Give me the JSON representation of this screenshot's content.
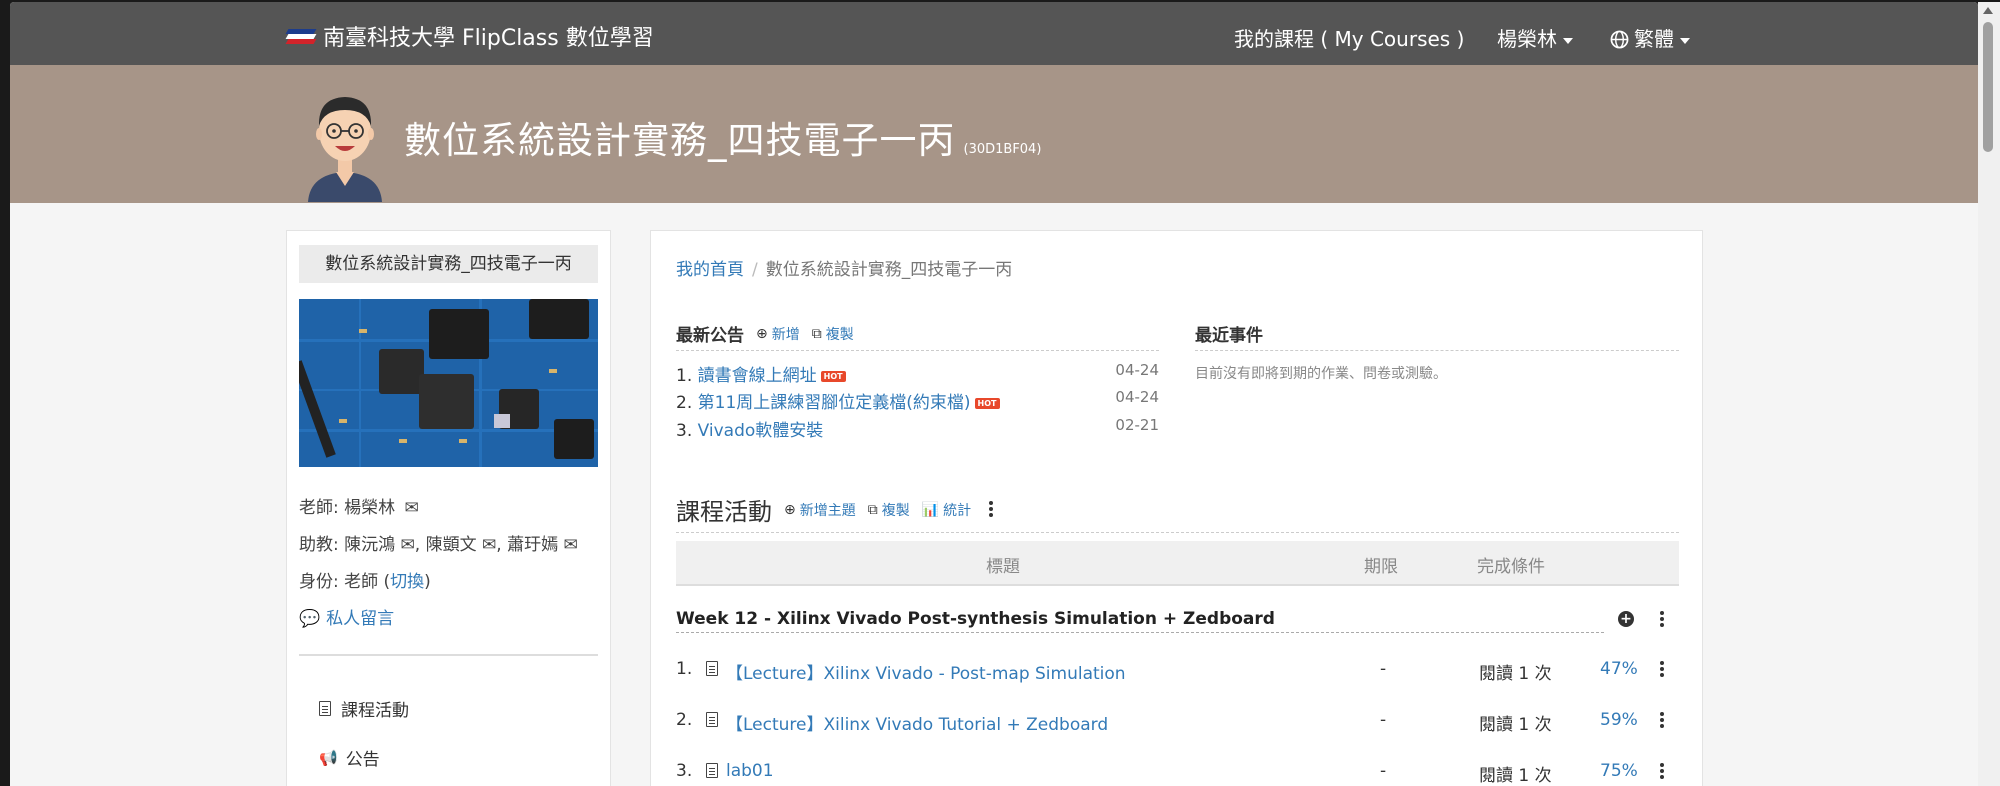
{
  "navbar": {
    "brand": "南臺科技大學 FlipClass 數位學習",
    "my_courses": "我的課程 ( My Courses )",
    "user": "楊榮林",
    "language": "繁體"
  },
  "banner": {
    "course_title": "數位系統設計實務_四技電子一丙",
    "course_code": "(30D1BF04)"
  },
  "sidebar": {
    "title": "數位系統設計實務_四技電子一丙",
    "teacher_label": "老師: 楊榮林",
    "ta_label": "助教:",
    "ta_names": [
      "陳沅鴻",
      "陳顗文",
      "蕭玗嫣"
    ],
    "role_label": "身份: 老師 (",
    "role_switch": "切換",
    "role_close": ")",
    "private_message": "私人留言",
    "menu": [
      {
        "label": "課程活動",
        "icon": "file-icon"
      },
      {
        "label": "公告",
        "icon": "megaphone-icon"
      }
    ]
  },
  "breadcrumb": {
    "home": "我的首頁",
    "separator": "/",
    "current": "數位系統設計實務_四技電子一丙"
  },
  "announcements": {
    "title": "最新公告",
    "add": "新增",
    "copy": "複製",
    "items": [
      {
        "num": "1.",
        "title": "讀書會線上網址",
        "hot": "HOT",
        "date": "04-24"
      },
      {
        "num": "2.",
        "title": "第11周上課練習腳位定義檔(約束檔)",
        "hot": "HOT",
        "date": "04-24"
      },
      {
        "num": "3.",
        "title": "Vivado軟體安裝",
        "hot": "",
        "date": "02-21"
      }
    ]
  },
  "events": {
    "title": "最近事件",
    "empty": "目前沒有即將到期的作業、問卷或測驗。"
  },
  "activities": {
    "title": "課程活動",
    "add_topic": "新增主題",
    "copy": "複製",
    "stats": "統計",
    "columns": {
      "title": "標題",
      "deadline": "期限",
      "completion": "完成條件"
    },
    "week": "Week 12 - Xilinx Vivado Post-synthesis Simulation + Zedboard",
    "rows": [
      {
        "num": "1.",
        "title": "【Lecture】Xilinx Vivado - Post-map Simulation",
        "deadline": "-",
        "condition": "閱讀 1 次",
        "percent": "47%"
      },
      {
        "num": "2.",
        "title": "【Lecture】Xilinx Vivado Tutorial + Zedboard",
        "deadline": "-",
        "condition": "閱讀 1 次",
        "percent": "59%"
      },
      {
        "num": "3.",
        "title": "lab01",
        "deadline": "-",
        "condition": "閱讀 1 次",
        "percent": "75%"
      }
    ]
  },
  "colors": {
    "navbar": "#555555",
    "banner": "#a79588",
    "link": "#337ab7",
    "hot": "#e8482b"
  }
}
